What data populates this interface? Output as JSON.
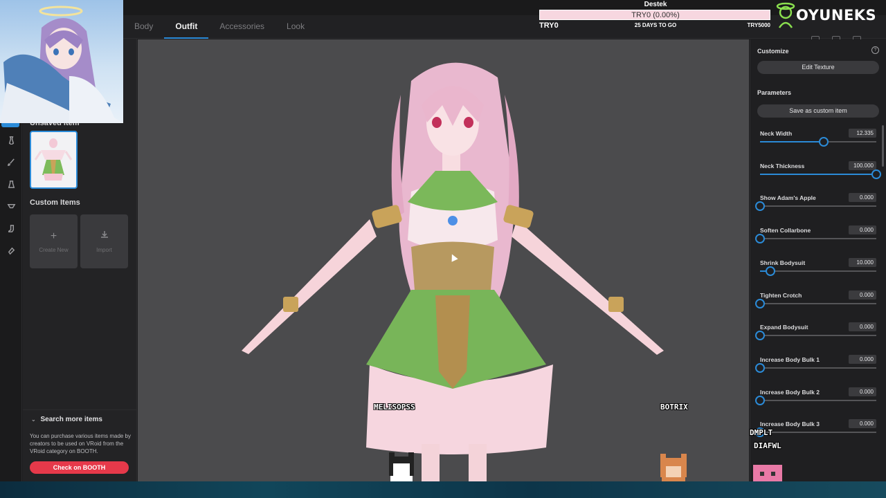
{
  "tabs": [
    "Body",
    "Outfit",
    "Accessories",
    "Look"
  ],
  "active_tab": "Outfit",
  "left_panel": {
    "unsaved_label": "Unsaved Item",
    "custom_items_label": "Custom Items",
    "create_new_label": "Create New",
    "import_label": "Import",
    "search_more_title": "Search more items",
    "search_more_desc": "You can purchase various items made by creators to be used on VRoid from the VRoid category on BOOTH.",
    "booth_button": "Check on BOOTH"
  },
  "right_panel": {
    "customize_label": "Customize",
    "edit_texture_button": "Edit Texture",
    "parameters_label": "Parameters",
    "save_custom_button": "Save as custom item",
    "params": [
      {
        "name": "Neck Width",
        "value": "12.335",
        "level": 0.55
      },
      {
        "name": "Neck Thickness",
        "value": "100.000",
        "level": 1.0
      },
      {
        "name": "Show Adam's Apple",
        "value": "0.000",
        "level": 0.0
      },
      {
        "name": "Soften Collarbone",
        "value": "0.000",
        "level": 0.0
      },
      {
        "name": "Shrink Bodysuit",
        "value": "10.000",
        "level": 0.09
      },
      {
        "name": "Tighten Crotch",
        "value": "0.000",
        "level": 0.0
      },
      {
        "name": "Expand Bodysuit",
        "value": "0.000",
        "level": 0.0
      },
      {
        "name": "Increase Body Bulk 1",
        "value": "0.000",
        "level": 0.0
      },
      {
        "name": "Increase Body Bulk 2",
        "value": "0.000",
        "level": 0.0
      },
      {
        "name": "Increase Body Bulk 3",
        "value": "0.000",
        "level": 0.0
      }
    ]
  },
  "overlay": {
    "goal_title": "Destek",
    "goal_text": "TRY0 (0.00%)",
    "goal_progress": 0.0,
    "goal_left": "TRY0",
    "goal_days": "25 DAYS TO GO",
    "goal_right": "TRY5000",
    "logo": "OYUNEKS",
    "chat_names": [
      "MELISOPSS",
      "BOTRIX",
      "DMPLT",
      "DIAFWL"
    ]
  },
  "colors": {
    "accent": "#2b8bd8",
    "booth": "#e6394a",
    "viewport_bg": "#4b4b4d"
  }
}
